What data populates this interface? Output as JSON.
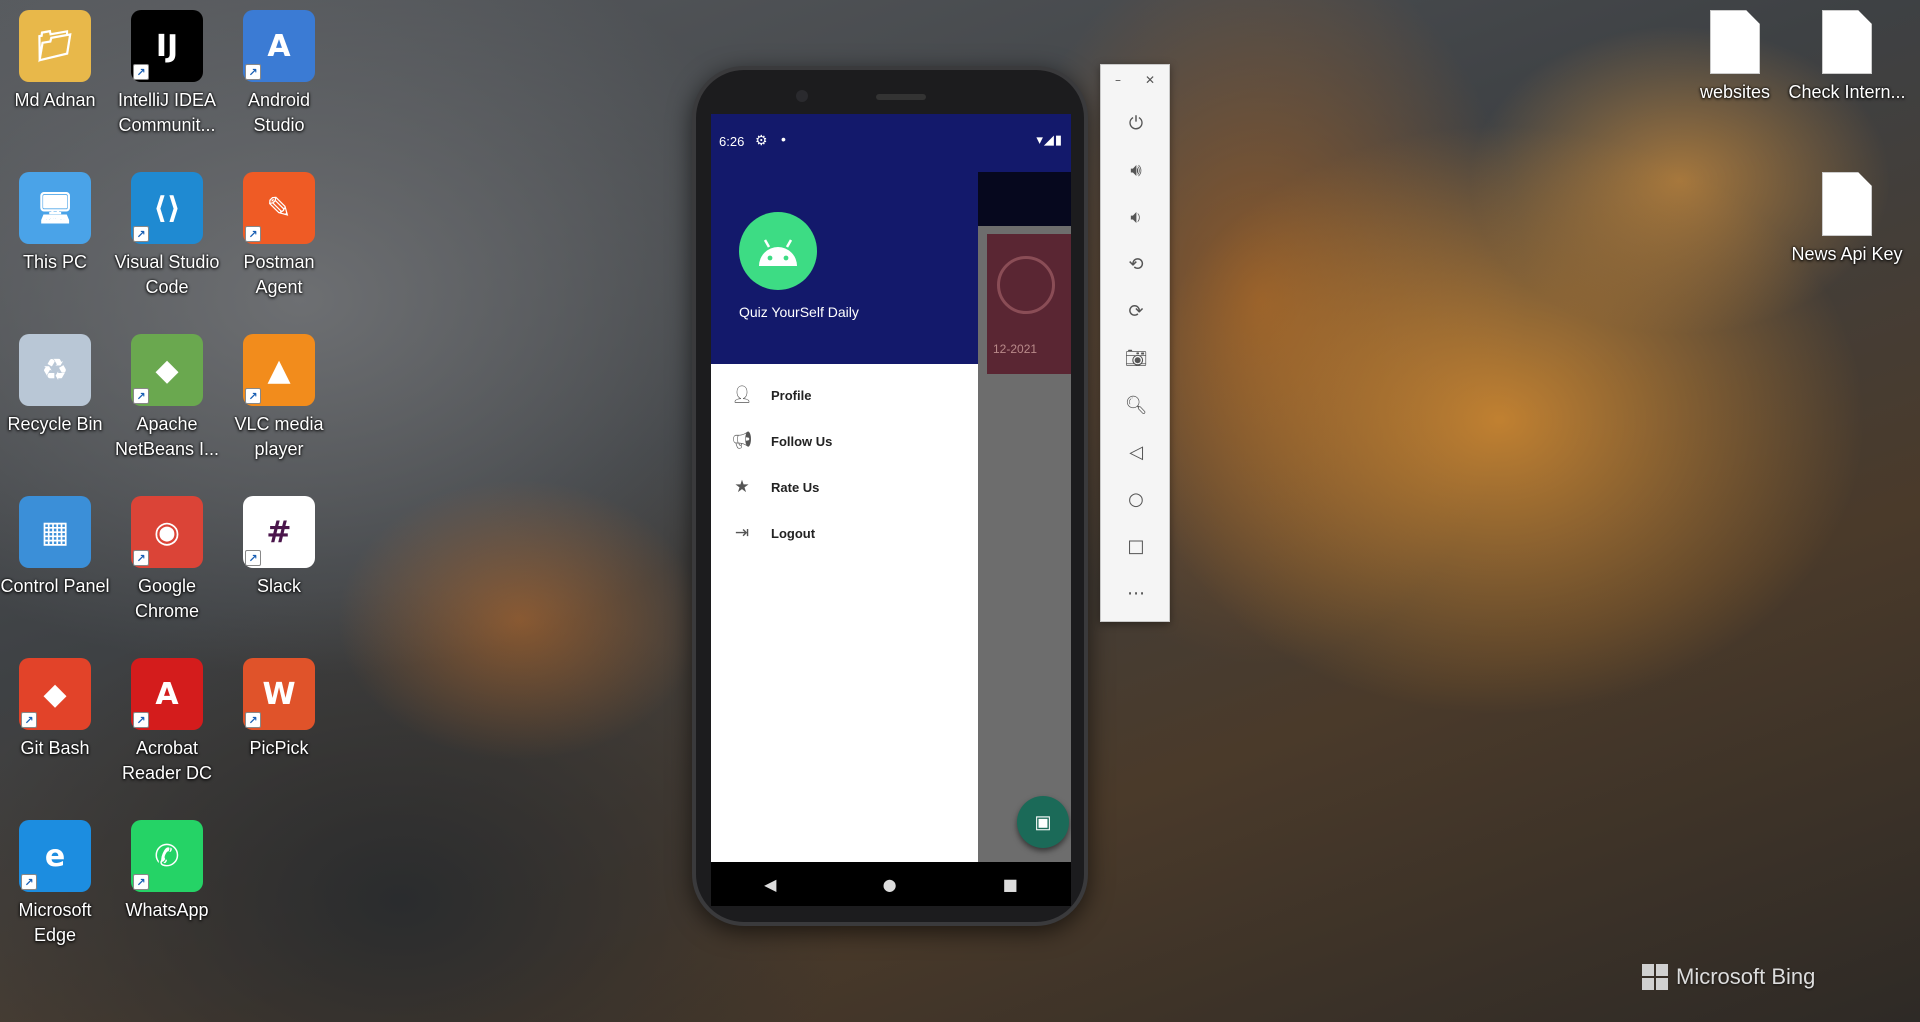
{
  "desktop": {
    "icons": [
      {
        "label": "Md Adnan",
        "icon": "user-folder-icon",
        "color": "#e8b84a"
      },
      {
        "label": "IntelliJ IDEA Communit...",
        "icon": "intellij-icon",
        "color": "#000000"
      },
      {
        "label": "Android Studio",
        "icon": "android-studio-icon",
        "color": "#3b7bd4"
      },
      {
        "label": "This PC",
        "icon": "computer-icon",
        "color": "#4aa3e8"
      },
      {
        "label": "Visual Studio Code",
        "icon": "vscode-icon",
        "color": "#1f8ad2"
      },
      {
        "label": "Postman Agent",
        "icon": "postman-icon",
        "color": "#ef5b25"
      },
      {
        "label": "Recycle Bin",
        "icon": "recycle-bin-icon",
        "color": "#b9c7d6"
      },
      {
        "label": "Apache NetBeans I...",
        "icon": "netbeans-icon",
        "color": "#6aa84f"
      },
      {
        "label": "VLC media player",
        "icon": "vlc-icon",
        "color": "#f28c1c"
      },
      {
        "label": "Control Panel",
        "icon": "control-panel-icon",
        "color": "#3b8fd8"
      },
      {
        "label": "Google Chrome",
        "icon": "chrome-icon",
        "color": "#db4437"
      },
      {
        "label": "Slack",
        "icon": "slack-icon",
        "color": "#ffffff"
      },
      {
        "label": "Git Bash",
        "icon": "git-bash-icon",
        "color": "#e24329"
      },
      {
        "label": "Acrobat Reader DC",
        "icon": "acrobat-icon",
        "color": "#d41c1c"
      },
      {
        "label": "PicPick",
        "icon": "picpick-icon",
        "color": "#e0532a"
      },
      {
        "label": "Microsoft Edge",
        "icon": "edge-icon",
        "color": "#1c8de0"
      },
      {
        "label": "WhatsApp",
        "icon": "whatsapp-icon",
        "color": "#25d366"
      }
    ],
    "right_icons": [
      {
        "label": "websites",
        "icon": "text-file-icon"
      },
      {
        "label": "Check Intern...",
        "icon": "text-file-icon"
      },
      {
        "label": "News Api Key",
        "icon": "text-file-icon"
      }
    ],
    "watermark": "Microsoft Bing"
  },
  "phone": {
    "status": {
      "time": "6:26"
    },
    "drawer": {
      "title": "Quiz YourSelf Daily",
      "items": [
        {
          "label": "Profile",
          "icon": "person-icon"
        },
        {
          "label": "Follow Us",
          "icon": "megaphone-icon"
        },
        {
          "label": "Rate Us",
          "icon": "star-icon"
        },
        {
          "label": "Logout",
          "icon": "logout-icon"
        }
      ]
    },
    "card": {
      "date": "12-2021"
    }
  },
  "emulator_toolbar": {
    "buttons": [
      "power",
      "volume-up",
      "volume-down",
      "rotate-left",
      "rotate-right",
      "screenshot",
      "zoom",
      "back",
      "home",
      "overview",
      "more"
    ]
  }
}
